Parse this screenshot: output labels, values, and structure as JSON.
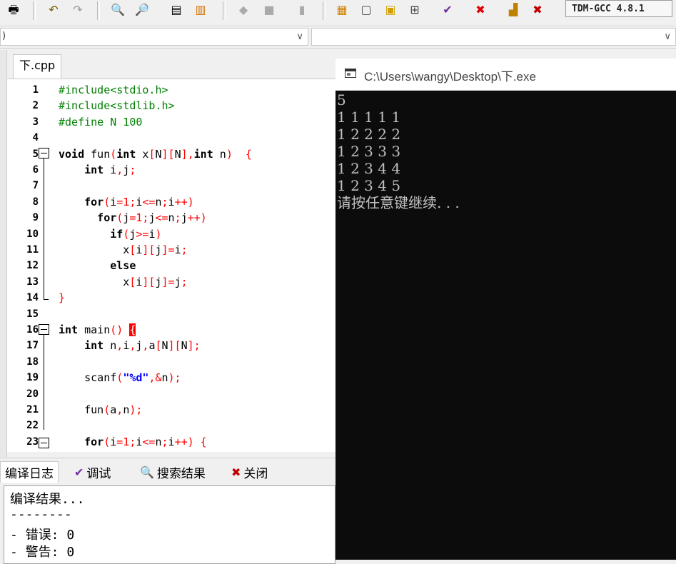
{
  "toolbar": {
    "compiler": "TDM-GCC 4.8.1",
    "icons": [
      "print-icon",
      "undo-icon",
      "redo-icon",
      "find-icon",
      "replace-icon",
      "indent-icon",
      "unindent-icon",
      "bookmark-icon",
      "bookmark2-icon",
      "goto-icon",
      "grid-icon",
      "window-icon",
      "color-icon",
      "layout-icon",
      "check-icon",
      "stop-icon",
      "chart-icon",
      "profile-icon"
    ]
  },
  "combo": {
    "left_text": ")",
    "arrow": "∨"
  },
  "editor": {
    "tab_label": "下.cpp",
    "lines": [
      {
        "n": "1",
        "code": [
          {
            "t": "#include<stdio.h>",
            "c": "pp"
          }
        ]
      },
      {
        "n": "2",
        "code": [
          {
            "t": "#include<stdlib.h>",
            "c": "pp"
          }
        ]
      },
      {
        "n": "3",
        "code": [
          {
            "t": "#define N 100",
            "c": "pp"
          }
        ]
      },
      {
        "n": "4",
        "code": []
      },
      {
        "n": "5",
        "code": [
          {
            "t": "void ",
            "c": "kw"
          },
          {
            "t": "fun",
            "c": "id"
          },
          {
            "t": "(",
            "c": "sym"
          },
          {
            "t": "int ",
            "c": "kw"
          },
          {
            "t": "x",
            "c": "id"
          },
          {
            "t": "[",
            "c": "sym"
          },
          {
            "t": "N",
            "c": "id"
          },
          {
            "t": "][",
            "c": "sym"
          },
          {
            "t": "N",
            "c": "id"
          },
          {
            "t": "],",
            "c": "sym"
          },
          {
            "t": "int ",
            "c": "kw"
          },
          {
            "t": "n",
            "c": "id"
          },
          {
            "t": ")  {",
            "c": "sym"
          }
        ]
      },
      {
        "n": "6",
        "code": [
          {
            "t": "    int ",
            "c": "kw"
          },
          {
            "t": "i",
            "c": "id"
          },
          {
            "t": ",",
            "c": "sym"
          },
          {
            "t": "j",
            "c": "id"
          },
          {
            "t": ";",
            "c": "sym"
          }
        ]
      },
      {
        "n": "7",
        "code": []
      },
      {
        "n": "8",
        "code": [
          {
            "t": "    for",
            "c": "kw"
          },
          {
            "t": "(",
            "c": "sym"
          },
          {
            "t": "i",
            "c": "id"
          },
          {
            "t": "=1;",
            "c": "sym"
          },
          {
            "t": "i",
            "c": "id"
          },
          {
            "t": "<=",
            "c": "sym"
          },
          {
            "t": "n",
            "c": "id"
          },
          {
            "t": ";",
            "c": "sym"
          },
          {
            "t": "i",
            "c": "id"
          },
          {
            "t": "++)",
            "c": "sym"
          }
        ]
      },
      {
        "n": "9",
        "code": [
          {
            "t": "      for",
            "c": "kw"
          },
          {
            "t": "(",
            "c": "sym"
          },
          {
            "t": "j",
            "c": "id"
          },
          {
            "t": "=1;",
            "c": "sym"
          },
          {
            "t": "j",
            "c": "id"
          },
          {
            "t": "<=",
            "c": "sym"
          },
          {
            "t": "n",
            "c": "id"
          },
          {
            "t": ";",
            "c": "sym"
          },
          {
            "t": "j",
            "c": "id"
          },
          {
            "t": "++)",
            "c": "sym"
          }
        ]
      },
      {
        "n": "10",
        "code": [
          {
            "t": "        if",
            "c": "kw"
          },
          {
            "t": "(",
            "c": "sym"
          },
          {
            "t": "j",
            "c": "id"
          },
          {
            "t": ">=",
            "c": "sym"
          },
          {
            "t": "i",
            "c": "id"
          },
          {
            "t": ")",
            "c": "sym"
          }
        ]
      },
      {
        "n": "11",
        "code": [
          {
            "t": "          x",
            "c": "id"
          },
          {
            "t": "[",
            "c": "sym"
          },
          {
            "t": "i",
            "c": "id"
          },
          {
            "t": "][",
            "c": "sym"
          },
          {
            "t": "j",
            "c": "id"
          },
          {
            "t": "]=",
            "c": "sym"
          },
          {
            "t": "i",
            "c": "id"
          },
          {
            "t": ";",
            "c": "sym"
          }
        ]
      },
      {
        "n": "12",
        "code": [
          {
            "t": "        else",
            "c": "kw"
          }
        ]
      },
      {
        "n": "13",
        "code": [
          {
            "t": "          x",
            "c": "id"
          },
          {
            "t": "[",
            "c": "sym"
          },
          {
            "t": "i",
            "c": "id"
          },
          {
            "t": "][",
            "c": "sym"
          },
          {
            "t": "j",
            "c": "id"
          },
          {
            "t": "]=",
            "c": "sym"
          },
          {
            "t": "j",
            "c": "id"
          },
          {
            "t": ";",
            "c": "sym"
          }
        ]
      },
      {
        "n": "14",
        "code": [
          {
            "t": "}",
            "c": "sym"
          }
        ]
      },
      {
        "n": "15",
        "code": []
      },
      {
        "n": "16",
        "code": [
          {
            "t": "int ",
            "c": "kw"
          },
          {
            "t": "main",
            "c": "id"
          },
          {
            "t": "() ",
            "c": "sym"
          },
          {
            "t": "{",
            "c": "hi"
          }
        ]
      },
      {
        "n": "17",
        "code": [
          {
            "t": "    int ",
            "c": "kw"
          },
          {
            "t": "n",
            "c": "id"
          },
          {
            "t": ",",
            "c": "sym"
          },
          {
            "t": "i",
            "c": "id"
          },
          {
            "t": ",",
            "c": "sym"
          },
          {
            "t": "j",
            "c": "id"
          },
          {
            "t": ",",
            "c": "sym"
          },
          {
            "t": "a",
            "c": "id"
          },
          {
            "t": "[",
            "c": "sym"
          },
          {
            "t": "N",
            "c": "id"
          },
          {
            "t": "][",
            "c": "sym"
          },
          {
            "t": "N",
            "c": "id"
          },
          {
            "t": "];",
            "c": "sym"
          }
        ]
      },
      {
        "n": "18",
        "code": []
      },
      {
        "n": "19",
        "code": [
          {
            "t": "    scanf",
            "c": "id"
          },
          {
            "t": "(",
            "c": "sym"
          },
          {
            "t": "\"%d\"",
            "c": "str"
          },
          {
            "t": ",&",
            "c": "sym"
          },
          {
            "t": "n",
            "c": "id"
          },
          {
            "t": ");",
            "c": "sym"
          }
        ]
      },
      {
        "n": "20",
        "code": []
      },
      {
        "n": "21",
        "code": [
          {
            "t": "    fun",
            "c": "id"
          },
          {
            "t": "(",
            "c": "sym"
          },
          {
            "t": "a",
            "c": "id"
          },
          {
            "t": ",",
            "c": "sym"
          },
          {
            "t": "n",
            "c": "id"
          },
          {
            "t": ");",
            "c": "sym"
          }
        ]
      },
      {
        "n": "22",
        "code": []
      },
      {
        "n": "23",
        "code": [
          {
            "t": "    for",
            "c": "kw"
          },
          {
            "t": "(",
            "c": "sym"
          },
          {
            "t": "i",
            "c": "id"
          },
          {
            "t": "=1;",
            "c": "sym"
          },
          {
            "t": "i",
            "c": "id"
          },
          {
            "t": "<=",
            "c": "sym"
          },
          {
            "t": "n",
            "c": "id"
          },
          {
            "t": ";",
            "c": "sym"
          },
          {
            "t": "i",
            "c": "id"
          },
          {
            "t": "++) {",
            "c": "sym"
          }
        ]
      }
    ]
  },
  "bottom_tabs": [
    {
      "label": "编译日志",
      "icon": "log-icon"
    },
    {
      "label": "调试",
      "icon": "debug-check-icon"
    },
    {
      "label": "搜索结果",
      "icon": "search-results-icon"
    },
    {
      "label": "关闭",
      "icon": "close-panel-icon"
    }
  ],
  "log": {
    "lines": [
      "编译结果...",
      "--------",
      "- 错误: 0",
      "- 警告: 0"
    ]
  },
  "console": {
    "title": "C:\\Users\\wangy\\Desktop\\下.exe",
    "lines": [
      "5",
      "1 1 1 1 1",
      "1 2 2 2 2",
      "1 2 3 3 3",
      "1 2 3 4 4",
      "1 2 3 4 5",
      "请按任意键继续. . ."
    ]
  },
  "colors": {
    "preprocessor": "#008000",
    "symbol": "#ff0000",
    "string": "#0000ff",
    "console_bg": "#0c0c0c",
    "console_text": "#c0c0c0"
  }
}
